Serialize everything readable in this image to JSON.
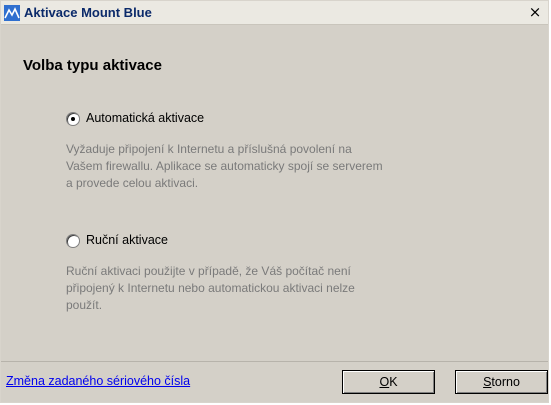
{
  "window": {
    "title": "Aktivace Mount Blue",
    "close_glyph": "×"
  },
  "heading": "Volba typu aktivace",
  "options": [
    {
      "label": "Automatická aktivace",
      "selected": true,
      "description": [
        "Vyžaduje připojení  k Internetu  a příslušná povolení na",
        "Vašem firewallu. Aplikace se automaticky spojí se serverem",
        "a provede celou aktivaci."
      ]
    },
    {
      "label": "Ruční aktivace",
      "selected": false,
      "description": [
        "Ruční aktivaci použijte v případě, že Váš počítač není",
        "připojený  k Internetu nebo automatickou aktivaci nelze",
        "použít."
      ]
    }
  ],
  "footer": {
    "link": "Změna zadaného sériového čísla",
    "ok_mnemonic": "O",
    "ok_rest": "K",
    "cancel_mnemonic": "S",
    "cancel_rest": "torno"
  },
  "colors": {
    "dialog_bg": "#d4d0c8",
    "titlebar_bg": "#ebe9e2",
    "title_text": "#0b2a6a",
    "description_text": "#7a7a7a",
    "link": "#0000ee"
  },
  "icons": {
    "app": "mount-blue-logo-icon",
    "close": "close-icon"
  }
}
